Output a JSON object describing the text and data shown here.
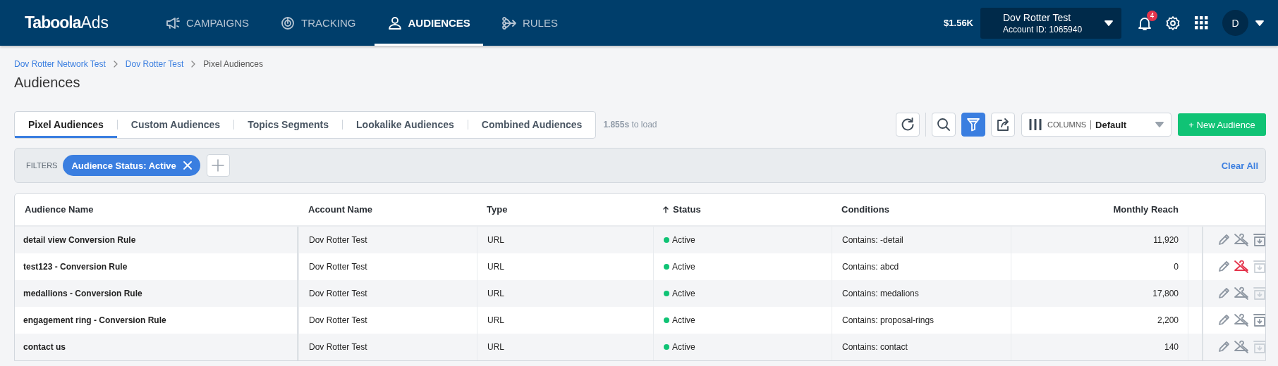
{
  "header": {
    "logo": {
      "brand": "Taboola",
      "product": "Ads"
    },
    "nav": [
      {
        "label": "CAMPAIGNS",
        "selected": false
      },
      {
        "label": "TRACKING",
        "selected": false
      },
      {
        "label": "AUDIENCES",
        "selected": true
      },
      {
        "label": "RULES",
        "selected": false
      }
    ],
    "balance": "$1.56K",
    "account": {
      "name": "Dov Rotter Test",
      "id": "Account ID: 1065940"
    },
    "notifications": "4",
    "avatar": "D"
  },
  "breadcrumbs": [
    {
      "label": "Dov Rotter Network Test",
      "link": true
    },
    {
      "label": "Dov Rotter Test",
      "link": true
    },
    {
      "label": "Pixel Audiences",
      "link": false
    }
  ],
  "title": "Audiences",
  "tabs": [
    {
      "label": "Pixel Audiences",
      "selected": true
    },
    {
      "label": "Custom Audiences",
      "selected": false
    },
    {
      "label": "Topics Segments",
      "selected": false
    },
    {
      "label": "Lookalike Audiences",
      "selected": false
    },
    {
      "label": "Combined Audiences",
      "selected": false
    }
  ],
  "load_time": {
    "value": "1.855s",
    "suffix": "to load"
  },
  "toolbar": {
    "tools": [
      {
        "kind": "refresh",
        "selected": false
      },
      {
        "kind": "search",
        "selected": false
      },
      {
        "kind": "filter",
        "selected": true
      },
      {
        "kind": "export",
        "selected": false
      }
    ],
    "columns": {
      "label": "COLUMNS",
      "value": "Default"
    },
    "new_button": "+ New Audience"
  },
  "filters": {
    "label": "FILTERS",
    "chips": [
      "Audience Status: Active"
    ],
    "clear": "Clear All"
  },
  "table": {
    "columns": [
      {
        "label": "Audience Name",
        "sorted": false
      },
      {
        "label": "Account Name",
        "sorted": false
      },
      {
        "label": "Type",
        "sorted": false
      },
      {
        "label": "Status",
        "sorted": true
      },
      {
        "label": "Conditions",
        "sorted": false
      },
      {
        "label": "Monthly Reach",
        "sorted": false
      }
    ],
    "rows": [
      {
        "name": "detail view Conversion Rule",
        "account": "Dov Rotter Test",
        "type": "URL",
        "status": "Active",
        "conditions": "Contains: -detail",
        "reach": "11,920",
        "alert": false,
        "archive_enabled": true
      },
      {
        "name": "test123 - Conversion Rule",
        "account": "Dov Rotter Test",
        "type": "URL",
        "status": "Active",
        "conditions": "Contains: abcd",
        "reach": "0",
        "alert": true,
        "archive_enabled": false
      },
      {
        "name": "medallions - Conversion Rule",
        "account": "Dov Rotter Test",
        "type": "URL",
        "status": "Active",
        "conditions": "Contains: medalions",
        "reach": "17,800",
        "alert": false,
        "archive_enabled": false
      },
      {
        "name": "engagement ring - Conversion Rule",
        "account": "Dov Rotter Test",
        "type": "URL",
        "status": "Active",
        "conditions": "Contains: proposal-rings",
        "reach": "2,200",
        "alert": false,
        "archive_enabled": true
      },
      {
        "name": "contact us",
        "account": "Dov Rotter Test",
        "type": "URL",
        "status": "Active",
        "conditions": "Contains: contact",
        "reach": "140",
        "alert": false,
        "archive_enabled": false
      }
    ]
  }
}
